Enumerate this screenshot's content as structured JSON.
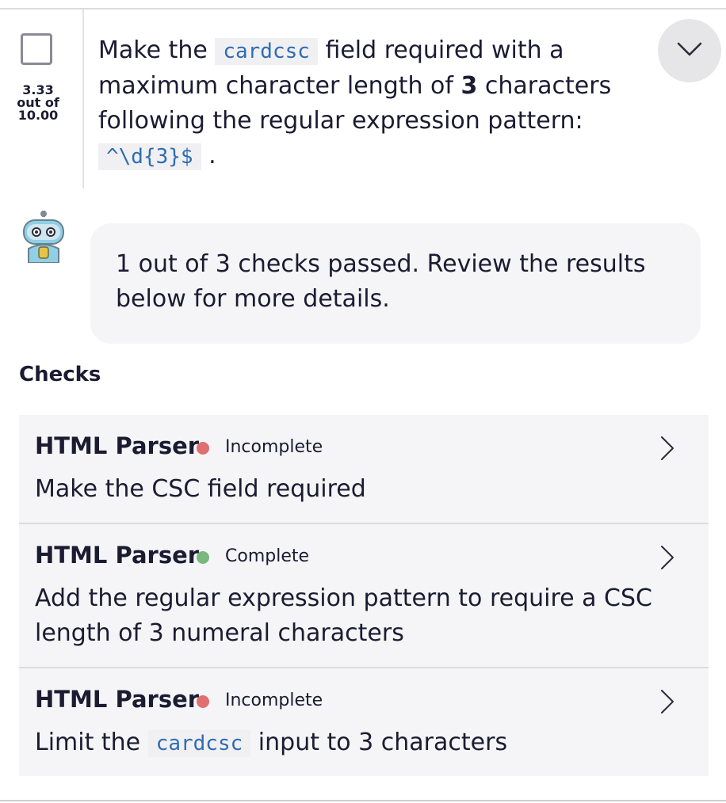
{
  "task": {
    "score_value": "3.33",
    "score_out_of": "out of",
    "score_total": "10.00",
    "text_1": "Make the ",
    "code_1": "cardcsc",
    "text_2": " field required with a maximum character length of ",
    "bold_value": "3",
    "text_3": " characters following the regular expression pattern: ",
    "code_2": "^\\d{3}$",
    "text_4": " ."
  },
  "feedback": {
    "message": "1 out of 3 checks passed. Review the results below for more details."
  },
  "checks_heading": "Checks",
  "checks": [
    {
      "title": "HTML Parser",
      "status": "Incomplete",
      "status_color": "#e07070",
      "description": "Make the CSC field required"
    },
    {
      "title": "HTML Parser",
      "status": "Complete",
      "status_color": "#7ab87e",
      "description": "Add the regular expression pattern to require a CSC length of 3 numeral characters"
    },
    {
      "title": "HTML Parser",
      "status": "Incomplete",
      "status_color": "#e07070",
      "description_before": "Limit the ",
      "description_code": "cardcsc",
      "description_after": " input to 3 characters"
    }
  ],
  "icons": {
    "expand": "chevron-down-icon",
    "avatar": "robot-avatar-icon",
    "row_chevron": "chevron-right-icon"
  }
}
